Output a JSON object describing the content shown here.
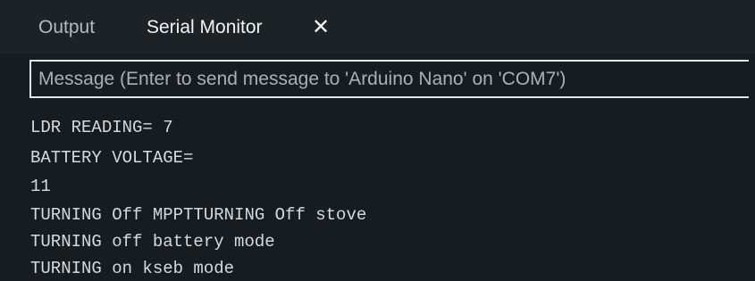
{
  "tabs": {
    "output_label": "Output",
    "serial_monitor_label": "Serial Monitor",
    "close_glyph": "✕",
    "active": "Serial Monitor"
  },
  "message": {
    "placeholder": "Message (Enter to send message to 'Arduino Nano' on 'COM7')",
    "value": ""
  },
  "serial_output": [
    "LDR READING= 7",
    "BATTERY VOLTAGE=",
    "11",
    "TURNING Off MPPTTURNING Off stove",
    "TURNING off battery mode",
    "TURNING on kseb mode"
  ],
  "colors": {
    "background": "#171c20",
    "tabbar": "#1c2226",
    "text": "#d6dadc",
    "input_border": "#e2e6e8"
  },
  "icons": {
    "close": "close-icon"
  }
}
